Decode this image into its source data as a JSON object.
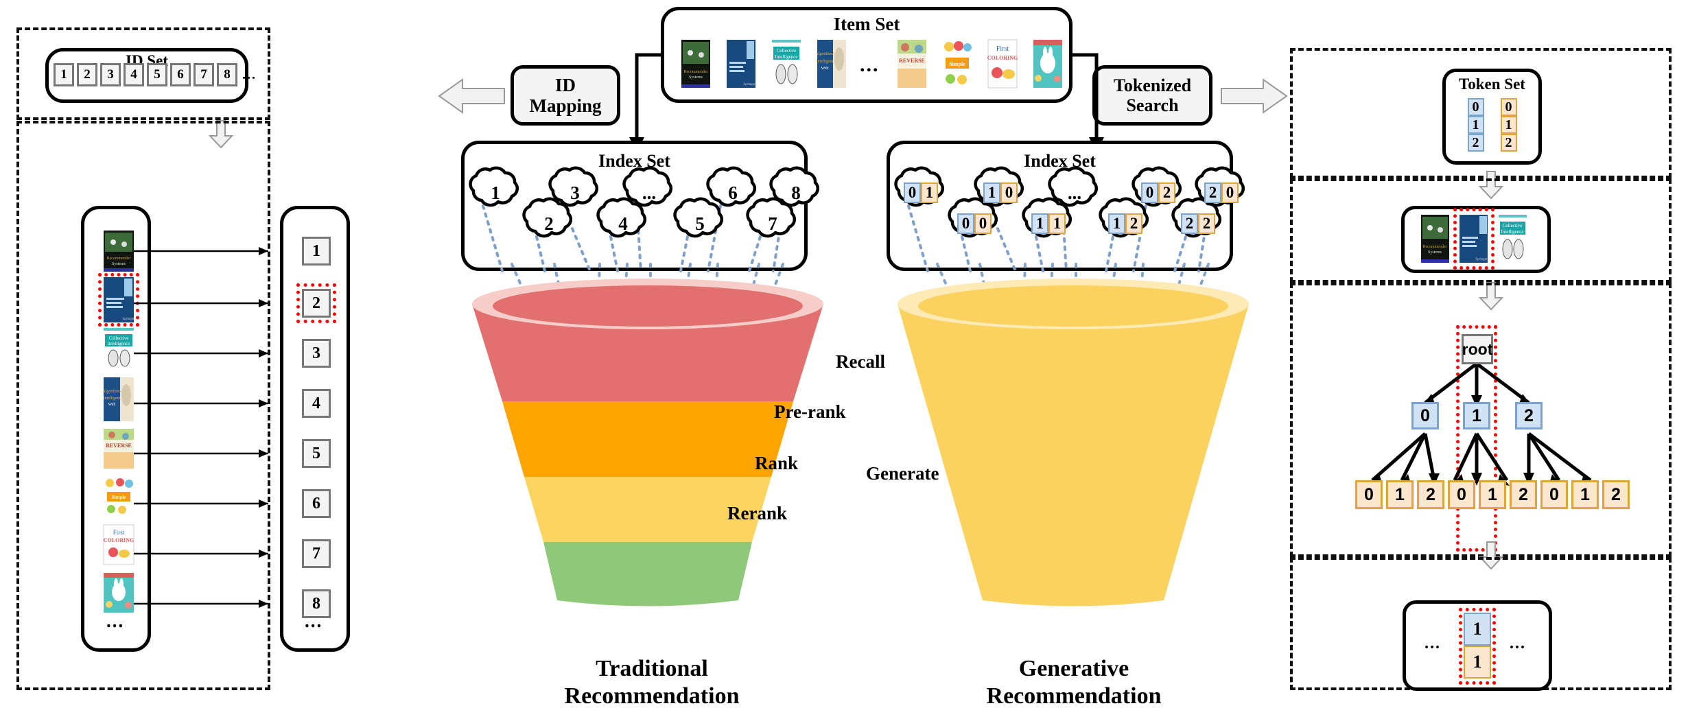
{
  "left_panel": {
    "id_set": {
      "title": "ID Set",
      "ids": [
        "1",
        "2",
        "3",
        "4",
        "5",
        "6",
        "7",
        "8"
      ],
      "ellipsis": "..."
    },
    "mapping": {
      "items_ellipsis": "...",
      "ids_ellipsis": "...",
      "ids": [
        "1",
        "2",
        "3",
        "4",
        "5",
        "6",
        "7",
        "8"
      ],
      "highlighted_id": "2",
      "books": [
        {
          "name": "recommender-systems",
          "title": "Recommender Systems"
        },
        {
          "name": "recommender-systems-handbook",
          "title": "Recommender Systems Handbook"
        },
        {
          "name": "collective-intelligence",
          "title": "Programming Collective Intelligence"
        },
        {
          "name": "algorithms-intelligent-web",
          "title": "Algorithms of the Intelligent Web"
        },
        {
          "name": "reverse-coloring-book",
          "title": "The Reverse Coloring Book"
        },
        {
          "name": "simple-big-coloring-toddlers",
          "title": "Simple & Big Coloring Book For Toddlers"
        },
        {
          "name": "first-coloring-book",
          "title": "My First Coloring Book"
        },
        {
          "name": "easter-coloring-book",
          "title": "Easter Coloring Book"
        }
      ]
    }
  },
  "item_set": {
    "title": "Item Set",
    "ellipsis": "...",
    "books_left": [
      "recommender-systems",
      "recommender-systems-handbook",
      "collective-intelligence",
      "algorithms-intelligent-web"
    ],
    "books_right": [
      "reverse-coloring-book",
      "simple-big-coloring-toddlers",
      "first-coloring-book",
      "easter-coloring-book"
    ]
  },
  "process": {
    "id_mapping": "ID\nMapping",
    "id_mapping_line1": "ID",
    "id_mapping_line2": "Mapping",
    "tokenized_search_line1": "Tokenized",
    "tokenized_search_line2": "Search"
  },
  "traditional": {
    "index_set": {
      "title": "Index Set",
      "top_row": [
        "1",
        "3",
        "...",
        "6",
        "8"
      ],
      "bottom_row": [
        "2",
        "4",
        "5",
        "7"
      ]
    },
    "funnel": {
      "name_line1": "Traditional",
      "name_line2": "Recommendation",
      "stages": [
        {
          "label": "Recall",
          "color": "#e2706f"
        },
        {
          "label": "Pre-rank",
          "color": "#ffa400"
        },
        {
          "label": "Rank",
          "color": "#fcd462"
        },
        {
          "label": "Rerank",
          "color": "#8fc878"
        }
      ],
      "rim_color": "#f6cdc9"
    }
  },
  "generative": {
    "index_set": {
      "title": "Index Set",
      "top_row": [
        {
          "tokens": [
            "0",
            "1"
          ]
        },
        {
          "tokens": [
            "1",
            "0"
          ]
        },
        {
          "tokens": [
            "..."
          ]
        },
        {
          "tokens": [
            "0",
            "2"
          ]
        },
        {
          "tokens": [
            "2",
            "0"
          ]
        }
      ],
      "bottom_row": [
        {
          "tokens": [
            "0",
            "0"
          ]
        },
        {
          "tokens": [
            "1",
            "1"
          ]
        },
        {
          "tokens": [
            "1",
            "2"
          ]
        },
        {
          "tokens": [
            "2",
            "2"
          ]
        }
      ]
    },
    "funnel": {
      "name_line1": "Generative",
      "name_line2": "Recommendation",
      "stage_label": "Generate",
      "color": "#fbd25f",
      "rim_color": "#fdeab4"
    }
  },
  "right_panel": {
    "token_set": {
      "title": "Token Set",
      "blue_column": [
        "0",
        "1",
        "2"
      ],
      "orange_column": [
        "0",
        "1",
        "2"
      ]
    },
    "items_row": {
      "books": [
        "recommender-systems",
        "recommender-systems-handbook",
        "collective-intelligence"
      ],
      "highlighted_index": 1
    },
    "tree": {
      "root": "root",
      "level1": [
        "0",
        "1",
        "2"
      ],
      "level2": [
        "0",
        "1",
        "2",
        "0",
        "1",
        "2",
        "0",
        "1",
        "2"
      ],
      "highlight_path": [
        "root",
        "1",
        "1"
      ]
    },
    "result": {
      "left_ellipsis": "...",
      "right_ellipsis": "...",
      "blue_token": "1",
      "orange_token": "1"
    }
  },
  "colors": {
    "blue_token_bg": "#d2e2f5",
    "blue_token_border": "#7ba3d0",
    "orange_token_bg": "#fce6cd",
    "orange_token_border": "#e0a43a",
    "highlight_red": "#ff0000",
    "dotted_link": "#7d9fc9"
  }
}
